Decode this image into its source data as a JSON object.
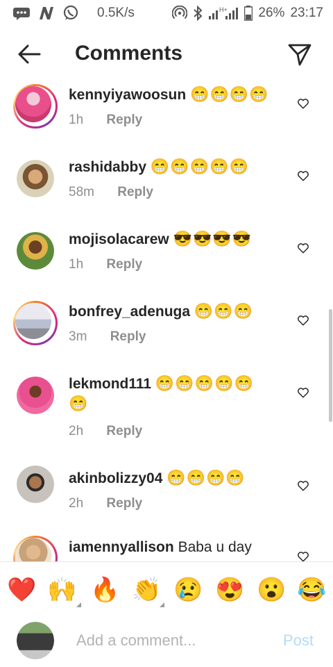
{
  "status_bar": {
    "network_speed": "0.5K/s",
    "network_type": "H+",
    "battery": "26%",
    "time": "23:17",
    "icons": [
      "messages-icon",
      "n-app-icon",
      "whatsapp-icon",
      "hotspot-icon",
      "bluetooth-icon",
      "signal-icon",
      "battery-icon"
    ]
  },
  "header": {
    "title": "Comments",
    "back_icon": "back-arrow-icon",
    "send_icon": "direct-send-icon"
  },
  "comments": [
    {
      "username": "kennyiyawoosun",
      "emojis": "😁😁😁😁",
      "text": "",
      "time": "1h",
      "reply_label": "Reply",
      "story_ring": true
    },
    {
      "username": "rashidabby",
      "emojis": "😁😁😁😁😁",
      "text": "",
      "time": "58m",
      "reply_label": "Reply",
      "story_ring": false
    },
    {
      "username": "mojisolacarew",
      "emojis": "😎😎😎😎",
      "text": "",
      "time": "1h",
      "reply_label": "Reply",
      "story_ring": false
    },
    {
      "username": "bonfrey_adenuga",
      "emojis": "😁😁😁",
      "text": "",
      "time": "3m",
      "reply_label": "Reply",
      "story_ring": true
    },
    {
      "username": "lekmond111",
      "emojis": "😁😁😁😁😁",
      "text": "",
      "emojis_line2": "😁",
      "time": "2h",
      "reply_label": "Reply",
      "story_ring": false
    },
    {
      "username": "akinbolizzy04",
      "emojis": "😁😁😁😁",
      "text": "",
      "time": "2h",
      "reply_label": "Reply",
      "story_ring": false
    },
    {
      "username": "iamennyallison",
      "emojis": "",
      "text": "Baba u day",
      "time": "",
      "reply_label": "",
      "story_ring": true
    }
  ],
  "emoji_bar": [
    "❤️",
    "🙌",
    "🔥",
    "👏",
    "😢",
    "😍",
    "😮",
    "😂"
  ],
  "composer": {
    "placeholder": "Add a comment...",
    "post_label": "Post"
  },
  "colors": {
    "text": "#262626",
    "meta": "#8e8e8e",
    "post_disabled": "#b3dbf9",
    "story_ring_start": "#f58529",
    "story_ring_end": "#dd2a7b"
  }
}
